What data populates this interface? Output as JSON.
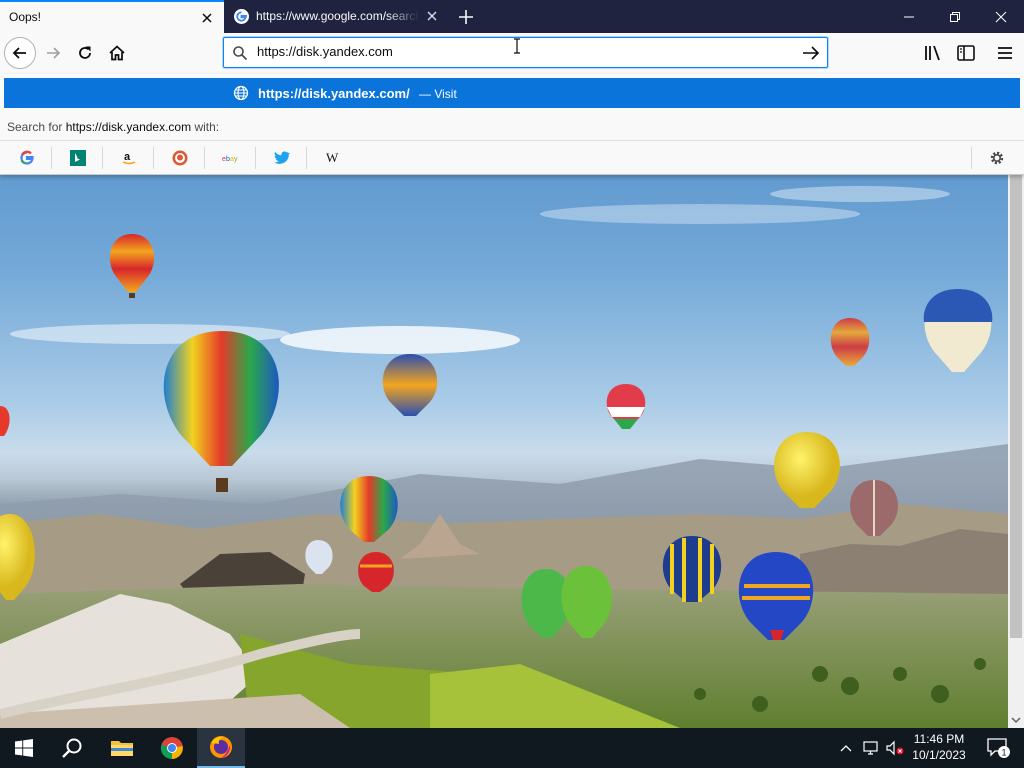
{
  "tabs": [
    {
      "title": "Oops!",
      "active": true
    },
    {
      "title": "https://www.google.com/search",
      "active": false,
      "favicon": "google-icon"
    }
  ],
  "urlbar": {
    "value": "https://disk.yandex.com",
    "placeholder": ""
  },
  "dropdown": {
    "suggestion_url": "https://disk.yandex.com/",
    "suggestion_action": "— Visit",
    "search_for_prefix": "Search for",
    "search_for_query": "https://disk.yandex.com",
    "search_for_suffix": "with:",
    "engines": [
      "google-icon",
      "bing-icon",
      "amazon-icon",
      "duckduckgo-icon",
      "ebay-icon",
      "twitter-icon",
      "wikipedia-icon"
    ]
  },
  "taskbar": {
    "apps": [
      "windows-start-icon",
      "search-icon",
      "file-explorer-icon",
      "chrome-icon",
      "firefox-icon"
    ],
    "time": "11:46 PM",
    "date": "10/1/2023",
    "notification_count": "1"
  },
  "colors": {
    "tabstrip": "#202340",
    "accent": "#0a84ff",
    "suggestion_highlight": "#0a74da",
    "taskbar": "#101820"
  }
}
